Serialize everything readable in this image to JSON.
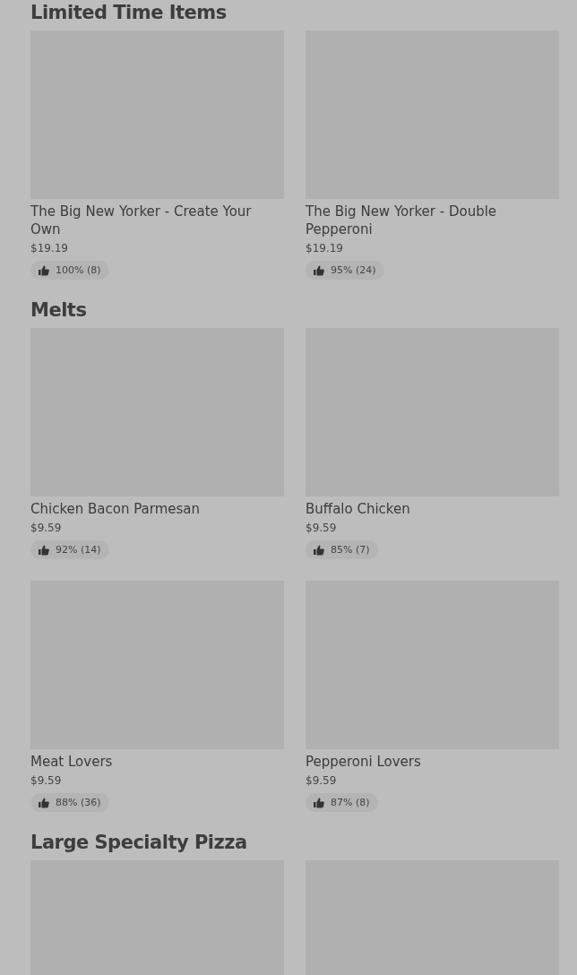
{
  "sections": [
    {
      "title": "Limited Time Items",
      "items": [
        {
          "kind": "product",
          "name": "The Big New Yorker - Create Your Own",
          "price": "$19.19",
          "rating": "100% (8)"
        },
        {
          "kind": "product",
          "name": "The Big New Yorker - Double Pepperoni",
          "price": "$19.19",
          "rating": "95% (24)"
        }
      ]
    },
    {
      "title": "Melts",
      "items": [
        {
          "kind": "product",
          "name": "Chicken Bacon Parmesan",
          "price": "$9.59",
          "rating": "92% (14)"
        },
        {
          "kind": "product",
          "name": "Buffalo Chicken",
          "price": "$9.59",
          "rating": "85% (7)"
        },
        {
          "kind": "product",
          "name": "Meat Lovers",
          "price": "$9.59",
          "rating": "88% (36)"
        },
        {
          "kind": "product",
          "name": "Pepperoni Lovers",
          "price": "$9.59",
          "rating": "87% (8)"
        }
      ]
    },
    {
      "title": "Large Specialty Pizza",
      "items": [
        {
          "kind": "image-only"
        },
        {
          "kind": "image-only"
        }
      ]
    }
  ]
}
